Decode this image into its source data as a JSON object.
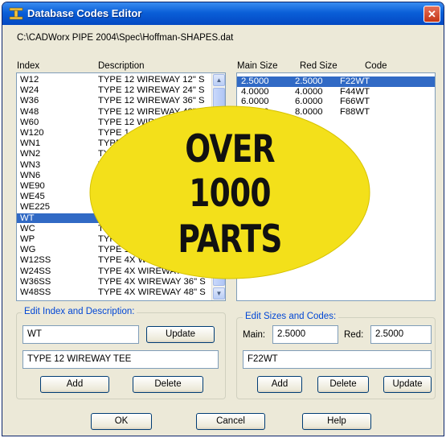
{
  "window": {
    "title": "Database Codes Editor",
    "close_glyph": "✕"
  },
  "file_path": "C:\\CADWorx PIPE 2004\\Spec\\Hoffman-SHAPES.dat",
  "left_list": {
    "headers": {
      "index": "Index",
      "description": "Description"
    },
    "rows": [
      {
        "index": "W12",
        "description": "TYPE 12 WIREWAY 12\" S"
      },
      {
        "index": "W24",
        "description": "TYPE 12 WIREWAY 24\" S"
      },
      {
        "index": "W36",
        "description": "TYPE 12 WIREWAY 36\" S"
      },
      {
        "index": "W48",
        "description": "TYPE 12 WIREWAY 48\" S"
      },
      {
        "index": "W60",
        "description": "TYPE 12 WIRE"
      },
      {
        "index": "W120",
        "description": "TYPE 1"
      },
      {
        "index": "WN1",
        "description": "TYPE"
      },
      {
        "index": "WN2",
        "description": "TY"
      },
      {
        "index": "WN3",
        "description": "T"
      },
      {
        "index": "WN6",
        "description": ""
      },
      {
        "index": "WE90",
        "description": ""
      },
      {
        "index": "WE45",
        "description": ""
      },
      {
        "index": "WE225",
        "description": ""
      },
      {
        "index": "WT",
        "description": "",
        "selected": true
      },
      {
        "index": "WC",
        "description": "TY"
      },
      {
        "index": "WP",
        "description": "TYPE"
      },
      {
        "index": "WG",
        "description": "TYPE 12"
      },
      {
        "index": "W12SS",
        "description": "TYPE 4X WIRE"
      },
      {
        "index": "W24SS",
        "description": "TYPE 4X WIREWAY 24\" S"
      },
      {
        "index": "W36SS",
        "description": "TYPE 4X WIREWAY 36\" S"
      },
      {
        "index": "W48SS",
        "description": "TYPE 4X WIREWAY 48\" S"
      }
    ]
  },
  "right_list": {
    "headers": {
      "main_size": "Main Size",
      "red_size": "Red Size",
      "code": "Code"
    },
    "rows": [
      {
        "main": "2.5000",
        "red": "2.5000",
        "code": "F22WT",
        "selected": true
      },
      {
        "main": "4.0000",
        "red": "4.0000",
        "code": "F44WT"
      },
      {
        "main": "6.0000",
        "red": "6.0000",
        "code": "F66WT"
      },
      {
        "main": "8.0000",
        "red": "8.0000",
        "code": "F88WT"
      }
    ]
  },
  "edit_index": {
    "group_label": "Edit Index and Description:",
    "index_value": "WT",
    "description_value": "TYPE 12 WIREWAY TEE",
    "update_label": "Update",
    "add_label": "Add",
    "delete_label": "Delete"
  },
  "edit_sizes": {
    "group_label": "Edit Sizes and Codes:",
    "main_label": "Main:",
    "main_value": "2.5000",
    "red_label": "Red:",
    "red_value": "2.5000",
    "code_value": "F22WT",
    "add_label": "Add",
    "delete_label": "Delete",
    "update_label": "Update"
  },
  "footer": {
    "ok_label": "OK",
    "cancel_label": "Cancel",
    "help_label": "Help"
  },
  "overlay": {
    "line1": "OVER",
    "line2": "1000",
    "line3": "PARTS",
    "color": "#f3e01a"
  }
}
